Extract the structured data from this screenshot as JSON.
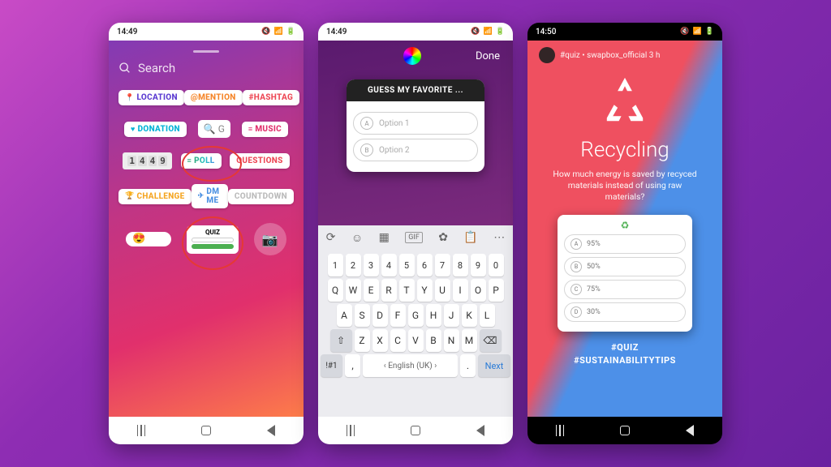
{
  "phone1": {
    "time": "14:49",
    "search_placeholder": "Search",
    "stickers": {
      "location": "LOCATION",
      "mention": "@MENTION",
      "hashtag": "#HASHTAG",
      "donation": "DONATION",
      "music": "MUSIC",
      "poll": "POLL",
      "questions": "QUESTIONS",
      "challenge": "CHALLENGE",
      "dmme": "DM ME",
      "countdown": "COUNTDOWN",
      "quiz": "QUIZ"
    },
    "clock_digits": [
      "1",
      "4",
      "4",
      "9"
    ]
  },
  "phone2": {
    "time": "14:49",
    "done": "Done",
    "quiz_prompt": "GUESS MY FAVORITE ...",
    "options": [
      {
        "letter": "A",
        "placeholder": "Option 1"
      },
      {
        "letter": "B",
        "placeholder": "Option 2"
      }
    ],
    "keyboard": {
      "numbers": [
        "1",
        "2",
        "3",
        "4",
        "5",
        "6",
        "7",
        "8",
        "9",
        "0"
      ],
      "row1": [
        "Q",
        "W",
        "E",
        "R",
        "T",
        "Y",
        "U",
        "I",
        "O",
        "P"
      ],
      "row2": [
        "A",
        "S",
        "D",
        "F",
        "G",
        "H",
        "J",
        "K",
        "L"
      ],
      "row3": [
        "Z",
        "X",
        "C",
        "V",
        "B",
        "N",
        "M"
      ],
      "shift": "⇧",
      "backspace": "⌫",
      "sym": "!#1",
      "lang": "English (UK)",
      "next": "Next"
    }
  },
  "phone3": {
    "time": "14:50",
    "header": "#quiz • swapbox_official  3 h",
    "title": "Recycling",
    "question": "How much energy is saved by recyced materials instead of using raw materials?",
    "options": [
      {
        "letter": "A",
        "label": "95%"
      },
      {
        "letter": "B",
        "label": "50%"
      },
      {
        "letter": "C",
        "label": "75%"
      },
      {
        "letter": "D",
        "label": "30%"
      }
    ],
    "tags": [
      "#QUIZ",
      "#SUSTAINABILITYTIPS"
    ]
  }
}
